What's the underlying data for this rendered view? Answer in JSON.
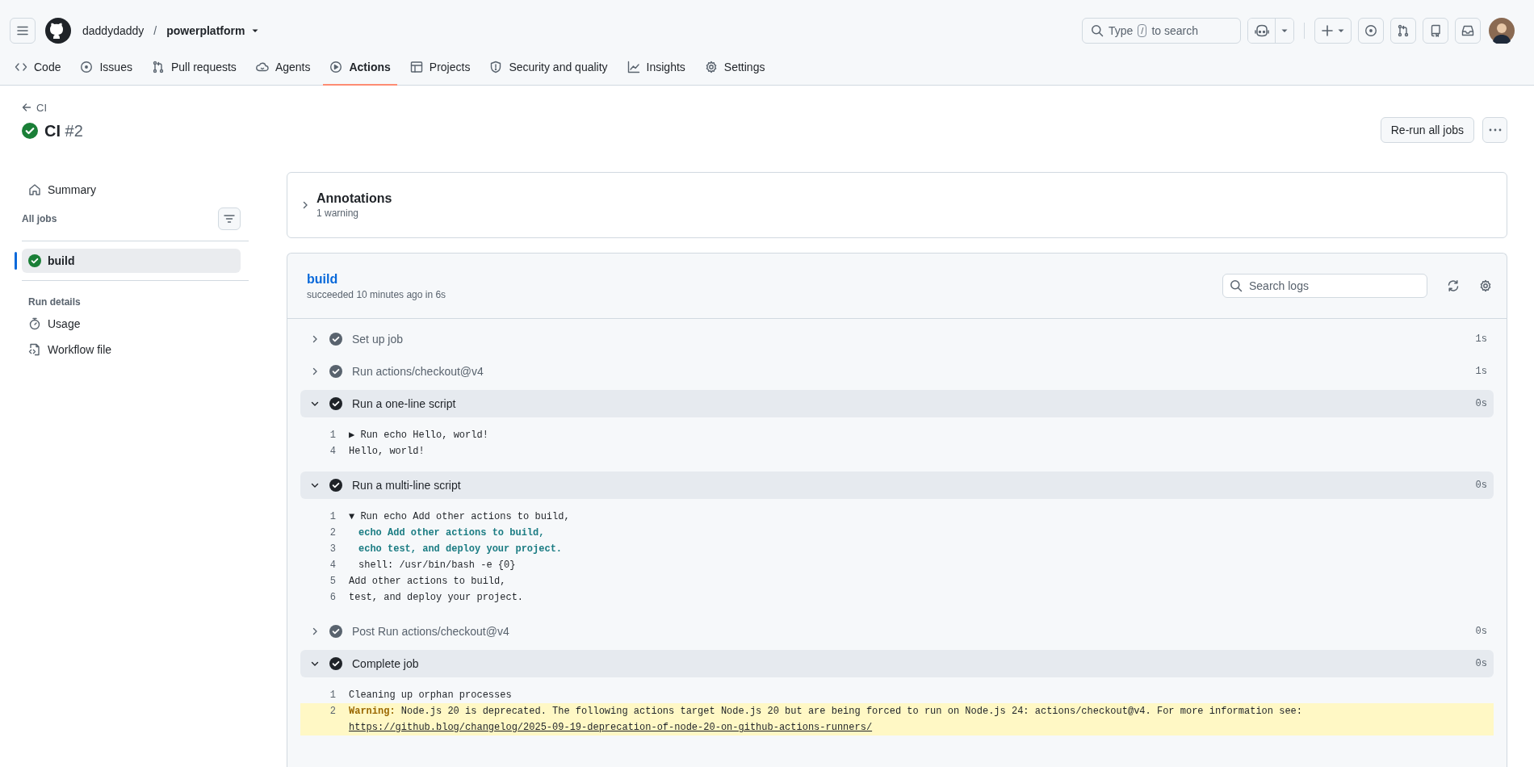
{
  "repo": {
    "owner": "daddydaddy",
    "separator": "/",
    "name": "powerplatform"
  },
  "global_search": {
    "before_key": "Type",
    "key": "/",
    "after_key": "to search"
  },
  "tabs": [
    {
      "label": "Code",
      "selected": false
    },
    {
      "label": "Issues",
      "selected": false
    },
    {
      "label": "Pull requests",
      "selected": false
    },
    {
      "label": "Agents",
      "selected": false
    },
    {
      "label": "Actions",
      "selected": true
    },
    {
      "label": "Projects",
      "selected": false
    },
    {
      "label": "Security and quality",
      "selected": false
    },
    {
      "label": "Insights",
      "selected": false
    },
    {
      "label": "Settings",
      "selected": false
    }
  ],
  "run": {
    "back_label": "CI",
    "workflow": "CI",
    "number": "#2",
    "rerun_label": "Re-run all jobs"
  },
  "sidebar": {
    "summary": "Summary",
    "jobs_heading": "All jobs",
    "jobs": [
      {
        "name": "build",
        "selected": true
      }
    ],
    "details_heading": "Run details",
    "details": [
      "Usage",
      "Workflow file"
    ]
  },
  "annotations": {
    "title": "Annotations",
    "summary": "1 warning",
    "expanded": false
  },
  "job": {
    "name": "build",
    "summary": "succeeded 10 minutes ago in 6s",
    "search": {
      "placeholder": "Search logs"
    },
    "steps": [
      {
        "name": "Set up job",
        "duration": "1s",
        "expanded": false
      },
      {
        "name": "Run actions/checkout@v4",
        "duration": "1s",
        "expanded": false
      },
      {
        "name": "Run a one-line script",
        "duration": "0s",
        "expanded": true,
        "lines": [
          {
            "number": "1",
            "kind": "group",
            "text": "▶ Run echo Hello, world!"
          },
          {
            "number": "4",
            "kind": "output",
            "text": "Hello, world!"
          }
        ]
      },
      {
        "name": "Run a multi-line script",
        "duration": "0s",
        "expanded": true,
        "lines": [
          {
            "number": "1",
            "kind": "group",
            "text": "▼ Run echo Add other actions to build,"
          },
          {
            "number": "2",
            "kind": "command",
            "text": "echo Add other actions to build,"
          },
          {
            "number": "3",
            "kind": "command",
            "text": "echo test, and deploy your project."
          },
          {
            "number": "4",
            "kind": "detail",
            "text": "shell: /usr/bin/bash -e {0}"
          },
          {
            "number": "5",
            "kind": "output",
            "text": "Add other actions to build,"
          },
          {
            "number": "6",
            "kind": "output",
            "text": "test, and deploy your project."
          }
        ]
      },
      {
        "name": "Post Run actions/checkout@v4",
        "duration": "0s",
        "expanded": false
      },
      {
        "name": "Complete job",
        "duration": "0s",
        "expanded": true,
        "lines": [
          {
            "number": "1",
            "kind": "output",
            "text": "Cleaning up orphan processes"
          },
          {
            "number": "2",
            "kind": "warning",
            "text": "**Warning:** Node.js 20 is deprecated. The following actions target Node.js 20 but are being forced to run on Node.js 24: actions/checkout@v4. For more information see:",
            "link": "https://github.blog/changelog/2025-09-19-deprecation-of-node-20-on-github-actions-runners/"
          }
        ]
      }
    ]
  }
}
